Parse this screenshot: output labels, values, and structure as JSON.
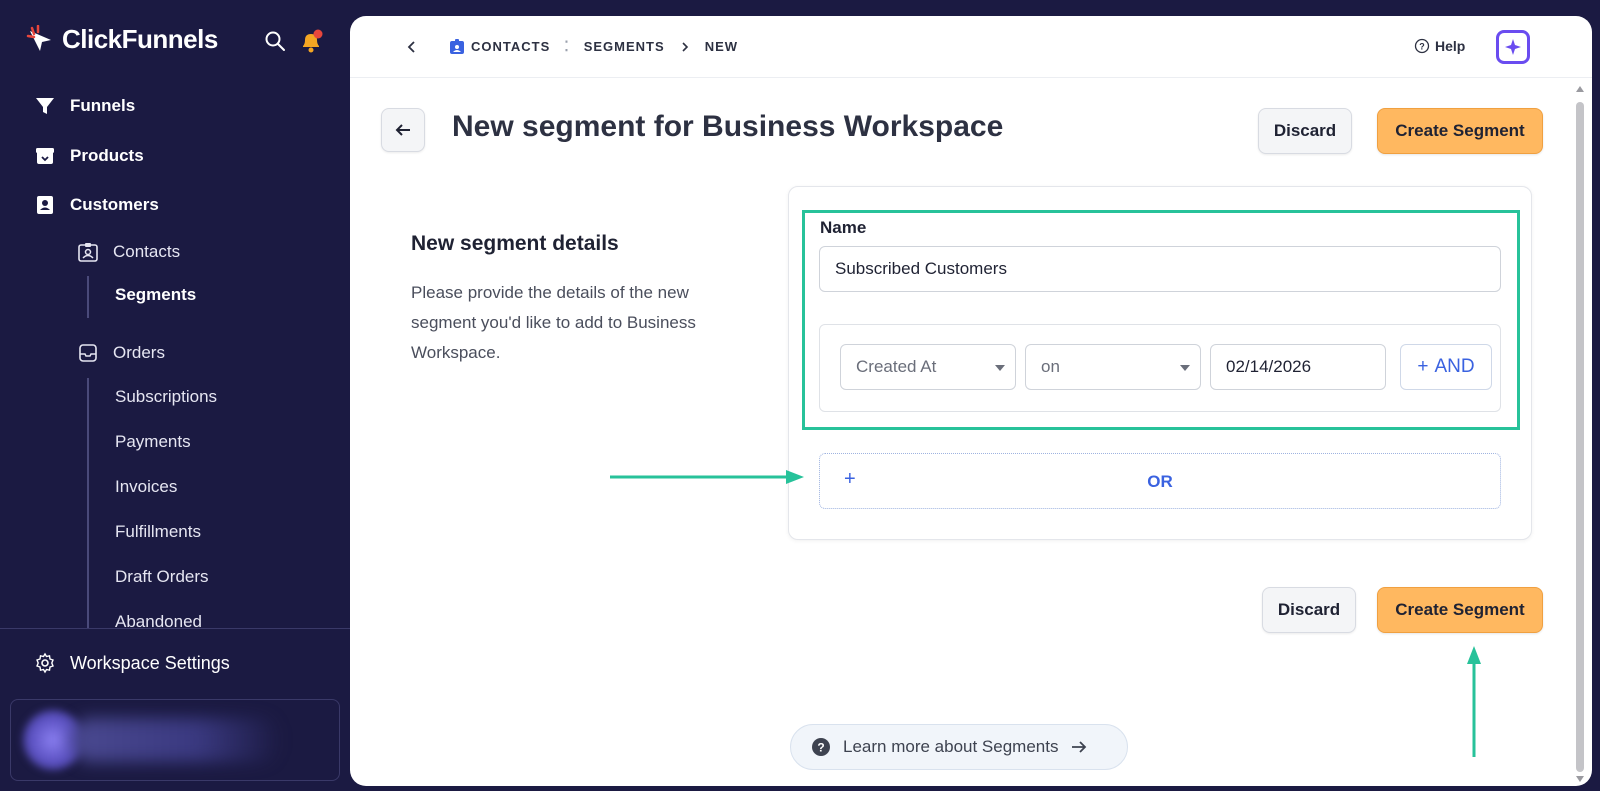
{
  "sidebar": {
    "brand": "ClickFunnels",
    "nav": [
      {
        "label": "Funnels",
        "icon": "funnel-icon"
      },
      {
        "label": "Products",
        "icon": "products-icon"
      },
      {
        "label": "Customers",
        "icon": "customers-icon"
      }
    ],
    "customers_sub": [
      {
        "label": "Contacts",
        "icon": "contacts-icon"
      },
      {
        "label": "Segments",
        "active": true
      }
    ],
    "orders": {
      "label": "Orders",
      "icon": "orders-icon"
    },
    "orders_sub": [
      "Subscriptions",
      "Payments",
      "Invoices",
      "Fulfillments",
      "Draft Orders",
      "Abandoned"
    ],
    "workspace_settings": "Workspace Settings"
  },
  "topbar": {
    "breadcrumbs": [
      "CONTACTS",
      "SEGMENTS",
      "NEW"
    ],
    "help": "Help"
  },
  "page": {
    "title": "New segment for Business Workspace",
    "discard": "Discard",
    "create": "Create Segment"
  },
  "details": {
    "heading": "New segment details",
    "description": "Please provide the details of the new segment you'd like to add to Business Workspace."
  },
  "form": {
    "name_label": "Name",
    "name_value": "Subscribed Customers",
    "rule": {
      "field": "Created At",
      "operator": "on",
      "date": "02/14/2026",
      "and_label": "AND"
    },
    "or_label": "OR"
  },
  "learn_more": "Learn more about Segments",
  "colors": {
    "sidebar_bg": "#1b1a42",
    "accent_orange": "#ffb860",
    "highlight_green": "#27c29a",
    "link_blue": "#3a62e0"
  }
}
